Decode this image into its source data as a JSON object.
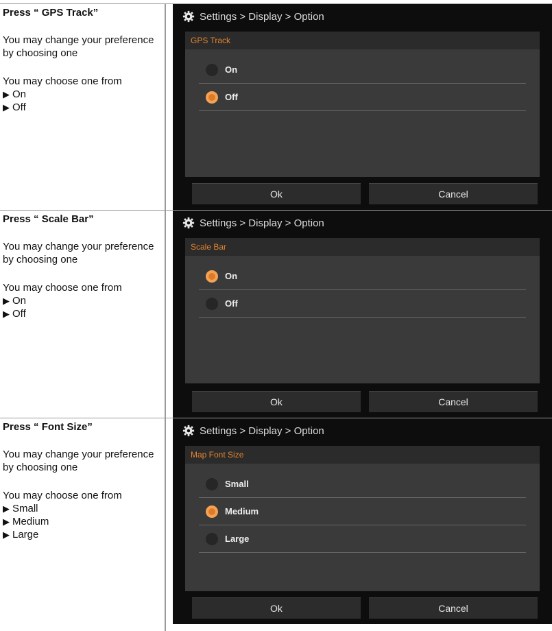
{
  "sections": [
    {
      "heading": "Press “ GPS Track”",
      "desc": "You may change your preference by choosing one",
      "choices_intro": "You may choose one from",
      "choices": [
        "On",
        "Off"
      ],
      "screen": {
        "breadcrumb": "Settings > Display > Option",
        "panel_title": "GPS Track",
        "options": [
          {
            "label": "On",
            "selected": false
          },
          {
            "label": "Off",
            "selected": true
          }
        ],
        "ok_label": "Ok",
        "cancel_label": "Cancel"
      }
    },
    {
      "heading": "Press “ Scale Bar”",
      "desc": "You may change your preference by choosing one",
      "choices_intro": "You may choose one from",
      "choices": [
        "On",
        "Off"
      ],
      "screen": {
        "breadcrumb": "Settings > Display > Option",
        "panel_title": "Scale Bar",
        "options": [
          {
            "label": "On",
            "selected": true
          },
          {
            "label": "Off",
            "selected": false
          }
        ],
        "ok_label": "Ok",
        "cancel_label": "Cancel"
      }
    },
    {
      "heading": "Press “ Font Size”",
      "desc": "You may change your preference by choosing one",
      "choices_intro": "You may choose one from",
      "choices": [
        "Small",
        "Medium",
        "Large"
      ],
      "screen": {
        "breadcrumb": "Settings > Display > Option",
        "panel_title": "Map Font Size",
        "options": [
          {
            "label": "Small",
            "selected": false
          },
          {
            "label": "Medium",
            "selected": true
          },
          {
            "label": "Large",
            "selected": false
          }
        ],
        "ok_label": "Ok",
        "cancel_label": "Cancel"
      }
    }
  ],
  "colors": {
    "accent": "#e07b25",
    "panel_bg": "#3a3a3a",
    "screen_bg": "#0d0d0d"
  },
  "icons": {
    "breadcrumb": "gear-icon",
    "choice_bullet": "triangle-right-icon"
  }
}
